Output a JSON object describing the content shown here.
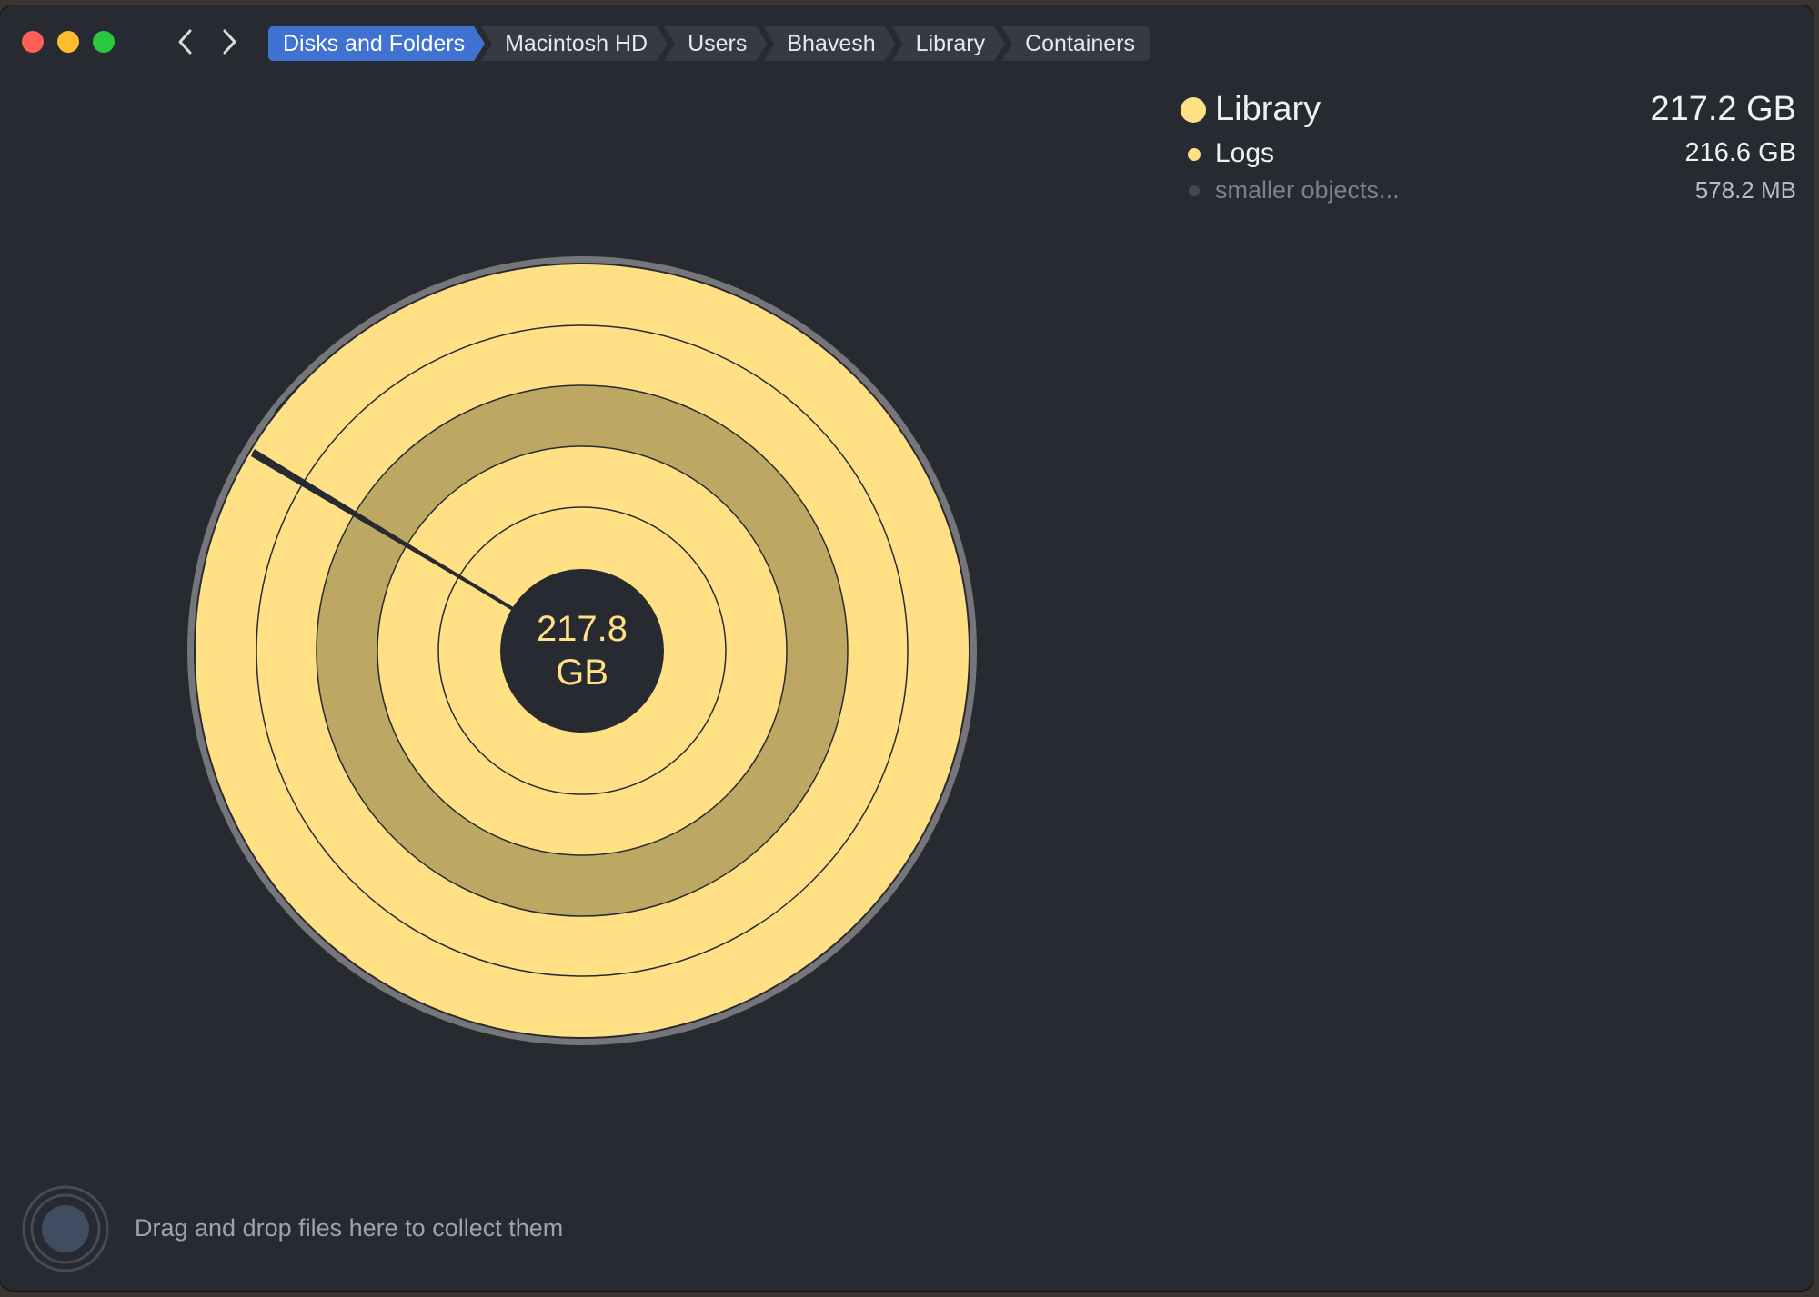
{
  "breadcrumb": [
    "Disks and Folders",
    "Macintosh HD",
    "Users",
    "Bhavesh",
    "Library",
    "Containers"
  ],
  "center": {
    "value": "217.8",
    "unit": "GB"
  },
  "legend": {
    "main": {
      "name": "Library",
      "size": "217.2 GB"
    },
    "items": [
      {
        "name": "Logs",
        "size": "216.6 GB"
      },
      {
        "name": "smaller objects...",
        "size": "578.2  MB"
      }
    ]
  },
  "dropzone": {
    "text": "Drag and drop files here to collect them"
  },
  "colors": {
    "background": "#272a31",
    "ring_light": "#ffe085",
    "ring_dark": "#bca763",
    "outer_ring": "#76767a",
    "active_crumb": "#3f72d1"
  }
}
